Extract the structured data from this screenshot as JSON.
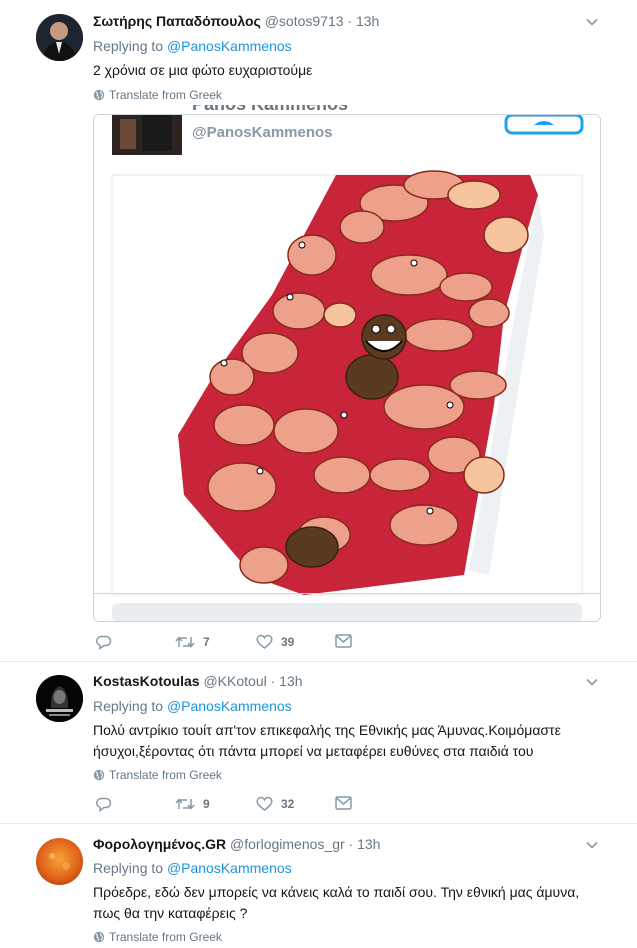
{
  "tweets": [
    {
      "name": "Σωτήρης Παπαδόπουλος",
      "handle": "@sotos9713",
      "dot": "·",
      "time": "13h",
      "replying_prefix": "Replying to",
      "replying_to": "@PanosKammenos",
      "text": "2 χρόνια σε μια φώτο ευχαριστούμε",
      "translate": "Translate from Greek",
      "retweets": "7",
      "likes": "39",
      "embed": {
        "name_partial": "Panos Kammenos",
        "handle": "@PanosKammenos"
      }
    },
    {
      "name": "KostasKotoulas",
      "handle": "@KKotoul",
      "dot": "·",
      "time": "13h",
      "replying_prefix": "Replying to",
      "replying_to": "@PanosKammenos",
      "text_line1": "Πολύ αντρίκιο τουίτ απ'τον επικεφαλής της Εθνικής μας Άμυνας.Κοιμόμαστε",
      "text_line2": "ήσυχοι,ξέροντας ότι πάντα μπορεί να μεταφέρει ευθύνες στα παιδιά του",
      "translate": "Translate from Greek",
      "retweets": "9",
      "likes": "32"
    },
    {
      "name": "Φορολογημένος.GR",
      "handle": "@forlogimenos_gr",
      "dot": "·",
      "time": "13h",
      "replying_prefix": "Replying to",
      "replying_to": "@PanosKammenos",
      "text_line1": "Πρόεδρε, εδώ δεν μπορείς να κάνεις καλά το παιδί σου. Την εθνική μας άμυνα,",
      "text_line2": "πως θα την καταφέρεις ?",
      "translate": "Translate from Greek"
    }
  ],
  "colors": {
    "link": "#1b95e0",
    "secondary": "#657786",
    "tie_red": "#c8243a"
  },
  "icons": [
    "reply-icon",
    "retweet-icon",
    "like-icon",
    "dm-icon",
    "globe-icon",
    "chevron-down-icon"
  ]
}
